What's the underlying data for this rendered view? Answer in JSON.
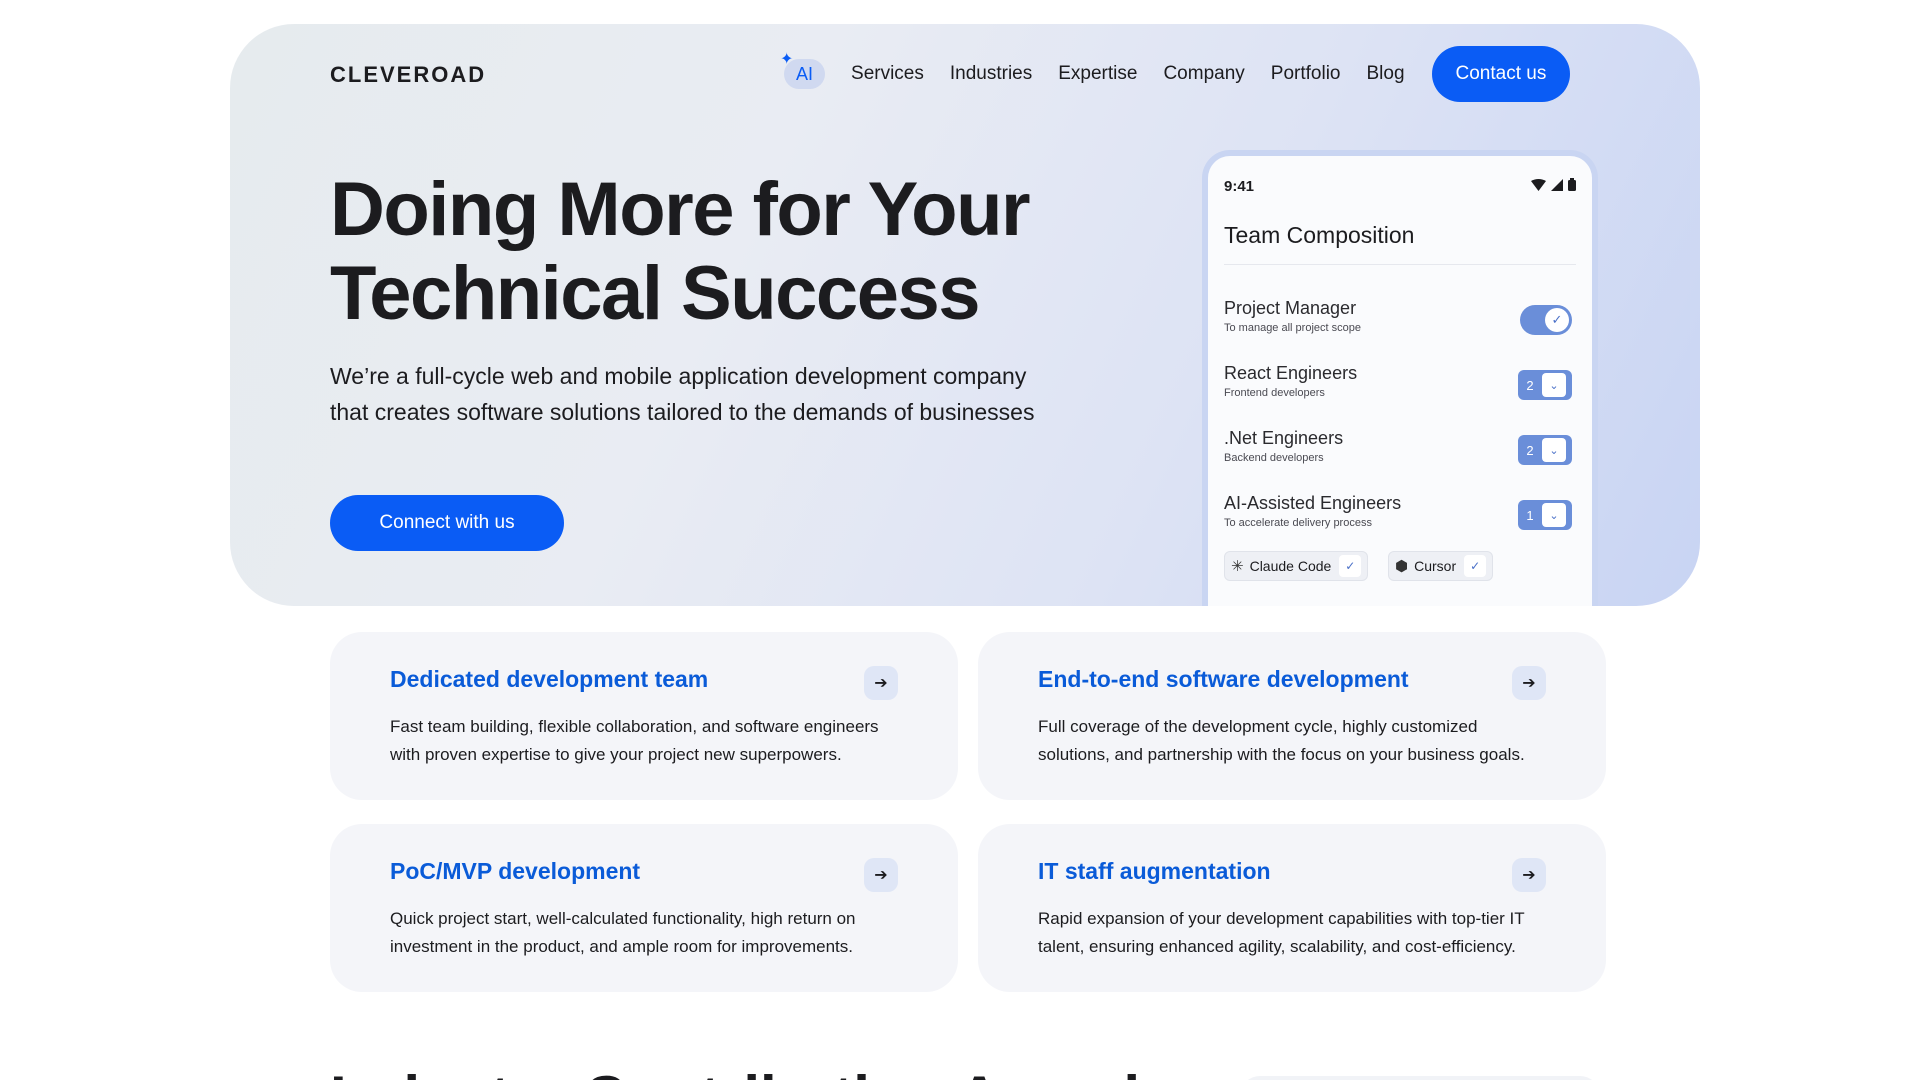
{
  "brand": {
    "logo": "CLEVEROAD",
    "accent": "#0a5cf5"
  },
  "nav": {
    "ai_label": "AI",
    "links": [
      "Services",
      "Industries",
      "Expertise",
      "Company",
      "Portfolio",
      "Blog"
    ],
    "contact_label": "Contact us"
  },
  "hero": {
    "title_line1": "Doing More for Your",
    "title_line2": "Technical Success",
    "subtitle_line1": "We’re a full-cycle web and mobile application development company",
    "subtitle_line2": "that creates software solutions tailored to the demands of businesses",
    "cta_label": "Connect with us"
  },
  "phone": {
    "time": "9:41",
    "title": "Team Composition",
    "roles": [
      {
        "name": "Project Manager",
        "desc": "To manage all project scope",
        "control": "toggle",
        "checked": true
      },
      {
        "name": "React Engineers",
        "desc": "Frontend developers",
        "control": "stepper",
        "count": "2"
      },
      {
        "name": ".Net Engineers",
        "desc": "Backend developers",
        "control": "stepper",
        "count": "2"
      },
      {
        "name": "AI-Assisted Engineers",
        "desc": "To accelerate delivery process",
        "control": "stepper",
        "count": "1"
      }
    ],
    "tools": [
      {
        "name": "Claude Code",
        "icon": "claude-asterisk-icon",
        "checked": true
      },
      {
        "name": "Cursor",
        "icon": "cursor-cube-icon",
        "checked": true
      }
    ]
  },
  "services": [
    {
      "title": "Dedicated development team",
      "desc_line1": "Fast team building, flexible collaboration, and software engineers",
      "desc_line2": "with proven expertise to give your project new superpowers."
    },
    {
      "title": "End-to-end software development",
      "desc_line1": "Full coverage of the development cycle, highly customized",
      "desc_line2": "solutions, and partnership with the focus on your business goals."
    },
    {
      "title": "PoC/MVP development",
      "desc_line1": "Quick project start, well-calculated functionality, high return on",
      "desc_line2": "investment in the product, and ample room for improvements."
    },
    {
      "title": "IT staff augmentation",
      "desc_line1": "Rapid expansion of your development capabilities with top-tier IT",
      "desc_line2": "talent, ensuring enhanced agility, scalability, and cost-efficiency."
    }
  ],
  "next_section": {
    "heading": "Industry Contribution Awards"
  }
}
